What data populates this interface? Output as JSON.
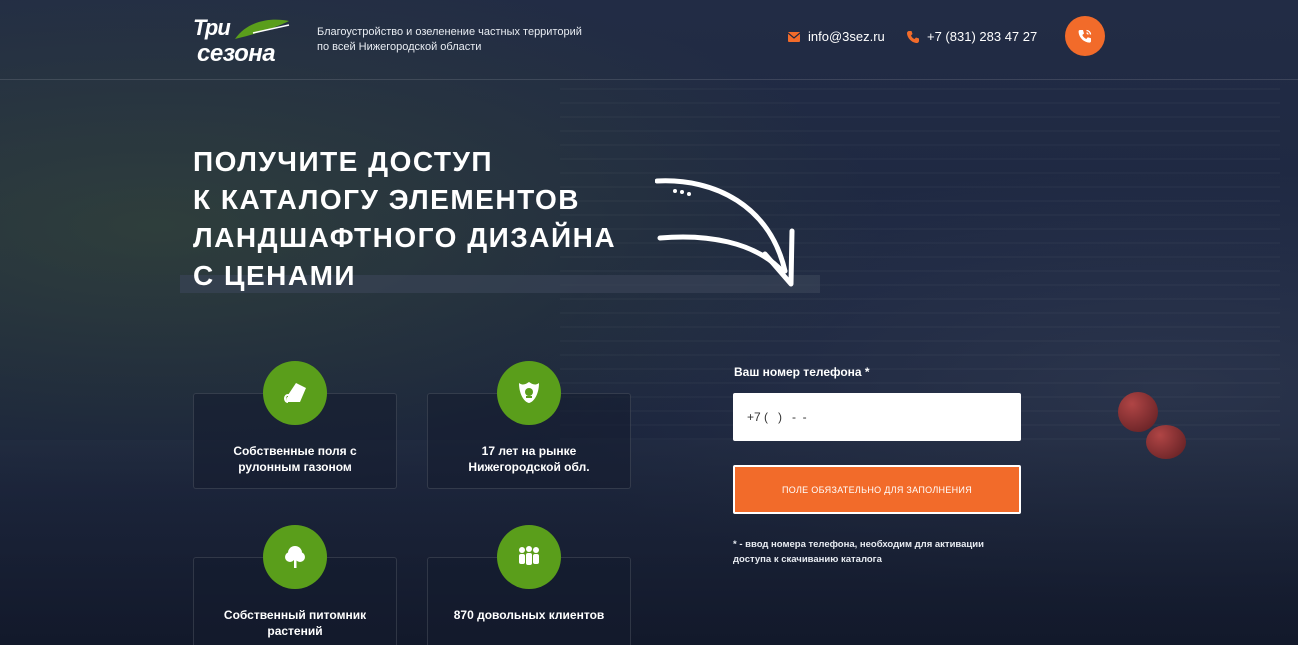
{
  "logo": {
    "line1": "Три",
    "line2": "сезона",
    "leaf_color": "#5a9e1b"
  },
  "header": {
    "tagline": "Благоустройство и озеленение частных территорий по всей Нижегородской области",
    "email": "info@3sez.ru",
    "phone": "+7 (831) 283 47 27",
    "email_icon": "envelope-icon",
    "phone_icon": "phone-icon",
    "call_icon": "phone-call-icon"
  },
  "hero": {
    "title_lines": [
      "ПОЛУЧИТЕ ДОСТУП",
      "К КАТАЛОГУ ЭЛЕМЕНТОВ",
      "ЛАНДШАФТНОГО ДИЗАЙНА",
      "С ЦЕНАМИ"
    ]
  },
  "features": [
    {
      "icon": "turf-roll-icon",
      "text": "Собственные поля с рулонным газоном"
    },
    {
      "icon": "emblem-icon",
      "text": "17 лет на рынке Нижегородской обл."
    },
    {
      "icon": "tree-icon",
      "text": "Собственный питомник растений"
    },
    {
      "icon": "people-icon",
      "text": "870 довольных клиентов"
    }
  ],
  "form": {
    "label": "Ваш номер телефона *",
    "phone_placeholder": "+7 (   )   -  -",
    "submit_label": "ПОЛЕ ОБЯЗАТЕЛЬНО ДЛЯ ЗАПОЛНЕНИЯ",
    "note": "* - ввод номера телефона, необходим для активации доступа к скачиванию каталога"
  },
  "colors": {
    "accent": "#f26b2a",
    "green": "#5a9e1b",
    "background": "#1c2640"
  }
}
